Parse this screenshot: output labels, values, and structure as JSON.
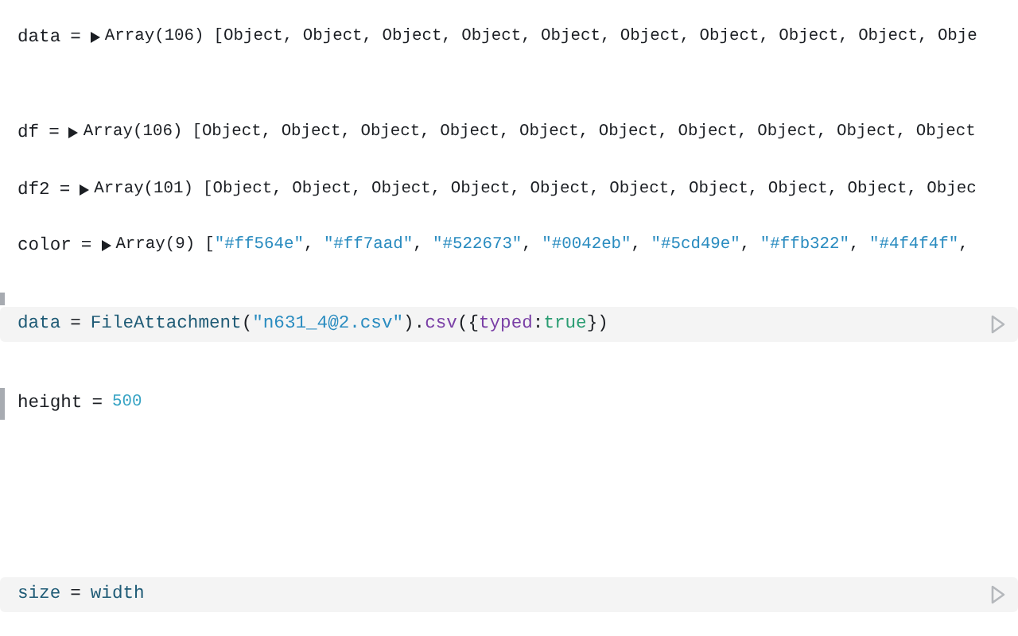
{
  "cells": [
    {
      "kind": "output",
      "marked": false,
      "tokens": [
        {
          "kind": "plain",
          "text": "data"
        },
        {
          "kind": "op",
          "text": "="
        }
      ],
      "expander": {
        "label": "Array(106)",
        "expanded": false
      },
      "value": [
        {
          "kind": "plain",
          "text": "[Object, Object, Object, Object, Object, Object, Object, Object, Object, Obje"
        }
      ]
    },
    {
      "kind": "output",
      "marked": false,
      "tokens": [
        {
          "kind": "plain",
          "text": "df"
        },
        {
          "kind": "op",
          "text": "="
        }
      ],
      "expander": {
        "label": "Array(106)",
        "expanded": false
      },
      "value": [
        {
          "kind": "plain",
          "text": "[Object, Object, Object, Object, Object, Object, Object, Object, Object, Object"
        }
      ]
    },
    {
      "kind": "output",
      "marked": false,
      "tokens": [
        {
          "kind": "plain",
          "text": "df2"
        },
        {
          "kind": "op",
          "text": "="
        }
      ],
      "expander": {
        "label": "Array(101)",
        "expanded": false
      },
      "value": [
        {
          "kind": "plain",
          "text": "[Object, Object, Object, Object, Object, Object, Object, Object, Object, Objec"
        }
      ]
    },
    {
      "kind": "output",
      "marked": false,
      "tokens": [
        {
          "kind": "plain",
          "text": "color"
        },
        {
          "kind": "op",
          "text": "="
        }
      ],
      "expander": {
        "label": "Array(9)",
        "expanded": false
      },
      "value": [
        {
          "kind": "plain",
          "text": "["
        },
        {
          "kind": "string",
          "text": "\"#ff564e\""
        },
        {
          "kind": "plain",
          "text": ", "
        },
        {
          "kind": "string",
          "text": "\"#ff7aad\""
        },
        {
          "kind": "plain",
          "text": ", "
        },
        {
          "kind": "string",
          "text": "\"#522673\""
        },
        {
          "kind": "plain",
          "text": ", "
        },
        {
          "kind": "string",
          "text": "\"#0042eb\""
        },
        {
          "kind": "plain",
          "text": ", "
        },
        {
          "kind": "string",
          "text": "\"#5cd49e\""
        },
        {
          "kind": "plain",
          "text": ", "
        },
        {
          "kind": "string",
          "text": "\"#ffb322\""
        },
        {
          "kind": "plain",
          "text": ", "
        },
        {
          "kind": "string",
          "text": "\"#4f4f4f\""
        },
        {
          "kind": "plain",
          "text": ","
        }
      ]
    },
    {
      "kind": "hidden",
      "marked": true
    },
    {
      "kind": "code",
      "marked": false,
      "tokens": [
        {
          "kind": "var",
          "text": "data"
        },
        {
          "kind": "op",
          "text": "="
        },
        {
          "kind": "var",
          "text": "FileAttachment"
        },
        {
          "kind": "plain",
          "text": "("
        },
        {
          "kind": "string",
          "text": "\"n631_4@2.csv\""
        },
        {
          "kind": "plain",
          "text": ")."
        },
        {
          "kind": "method",
          "text": "csv"
        },
        {
          "kind": "plain",
          "text": "({"
        },
        {
          "kind": "prop",
          "text": "typed"
        },
        {
          "kind": "plain",
          "text": ":"
        },
        {
          "kind": "bool",
          "text": "true"
        },
        {
          "kind": "plain",
          "text": "})"
        }
      ]
    },
    {
      "kind": "output",
      "marked": true,
      "tokens": [
        {
          "kind": "plain",
          "text": "height"
        },
        {
          "kind": "op",
          "text": "="
        }
      ],
      "value": [
        {
          "kind": "number",
          "text": "500"
        }
      ]
    },
    {
      "kind": "code",
      "marked": false,
      "tokens": [
        {
          "kind": "var",
          "text": "size"
        },
        {
          "kind": "op",
          "text": "="
        },
        {
          "kind": "var",
          "text": "width"
        }
      ]
    }
  ]
}
